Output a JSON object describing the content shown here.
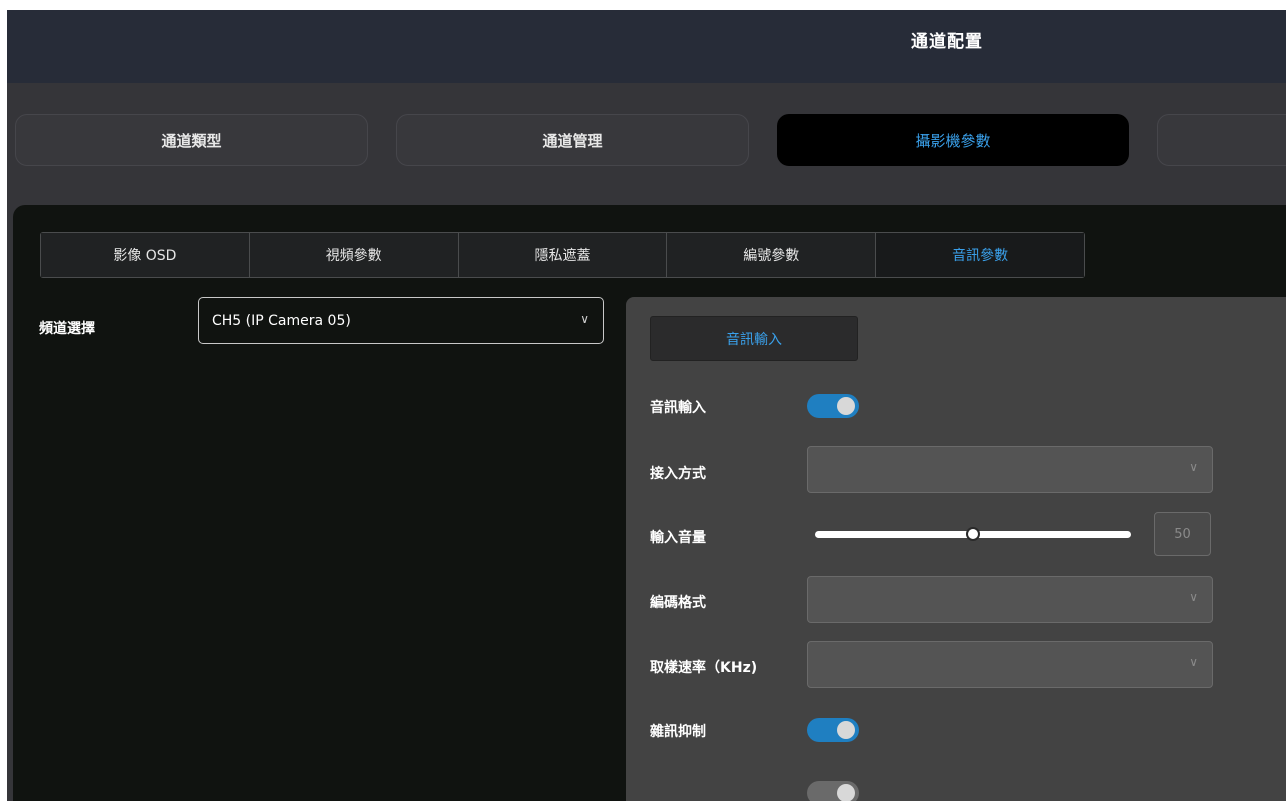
{
  "window": {
    "title": "通道配置"
  },
  "main_tabs": [
    {
      "label": "通道類型",
      "active": false
    },
    {
      "label": "通道管理",
      "active": false
    },
    {
      "label": "攝影機參數",
      "active": true
    },
    {
      "label": "",
      "active": false
    }
  ],
  "sub_tabs": [
    {
      "label": "影像 OSD",
      "active": false
    },
    {
      "label": "視頻參數",
      "active": false
    },
    {
      "label": "隱私遮蓋",
      "active": false
    },
    {
      "label": "編號參數",
      "active": false
    },
    {
      "label": "音訊參數",
      "active": true
    }
  ],
  "channel": {
    "label": "頻道選擇",
    "value": "CH5 (IP Camera 05)",
    "chevron": "chevron-down-icon"
  },
  "audio": {
    "section_tab": "音訊輸入",
    "audio_input": {
      "label": "音訊輸入",
      "on": true
    },
    "access_mode": {
      "label": "接入方式",
      "value": ""
    },
    "input_volume": {
      "label": "輸入音量",
      "value": "50",
      "fraction": 0.5
    },
    "codec": {
      "label": "編碼格式",
      "value": ""
    },
    "sample_rate": {
      "label": "取樣速率（KHz)",
      "value": ""
    },
    "noise_suppression": {
      "label": "雜訊抑制",
      "on": true
    }
  },
  "colors": {
    "accent": "#3aa0ea",
    "toggle_on": "#1f7fc1",
    "panel_bg": "#101310",
    "audio_panel_bg": "#434343"
  }
}
